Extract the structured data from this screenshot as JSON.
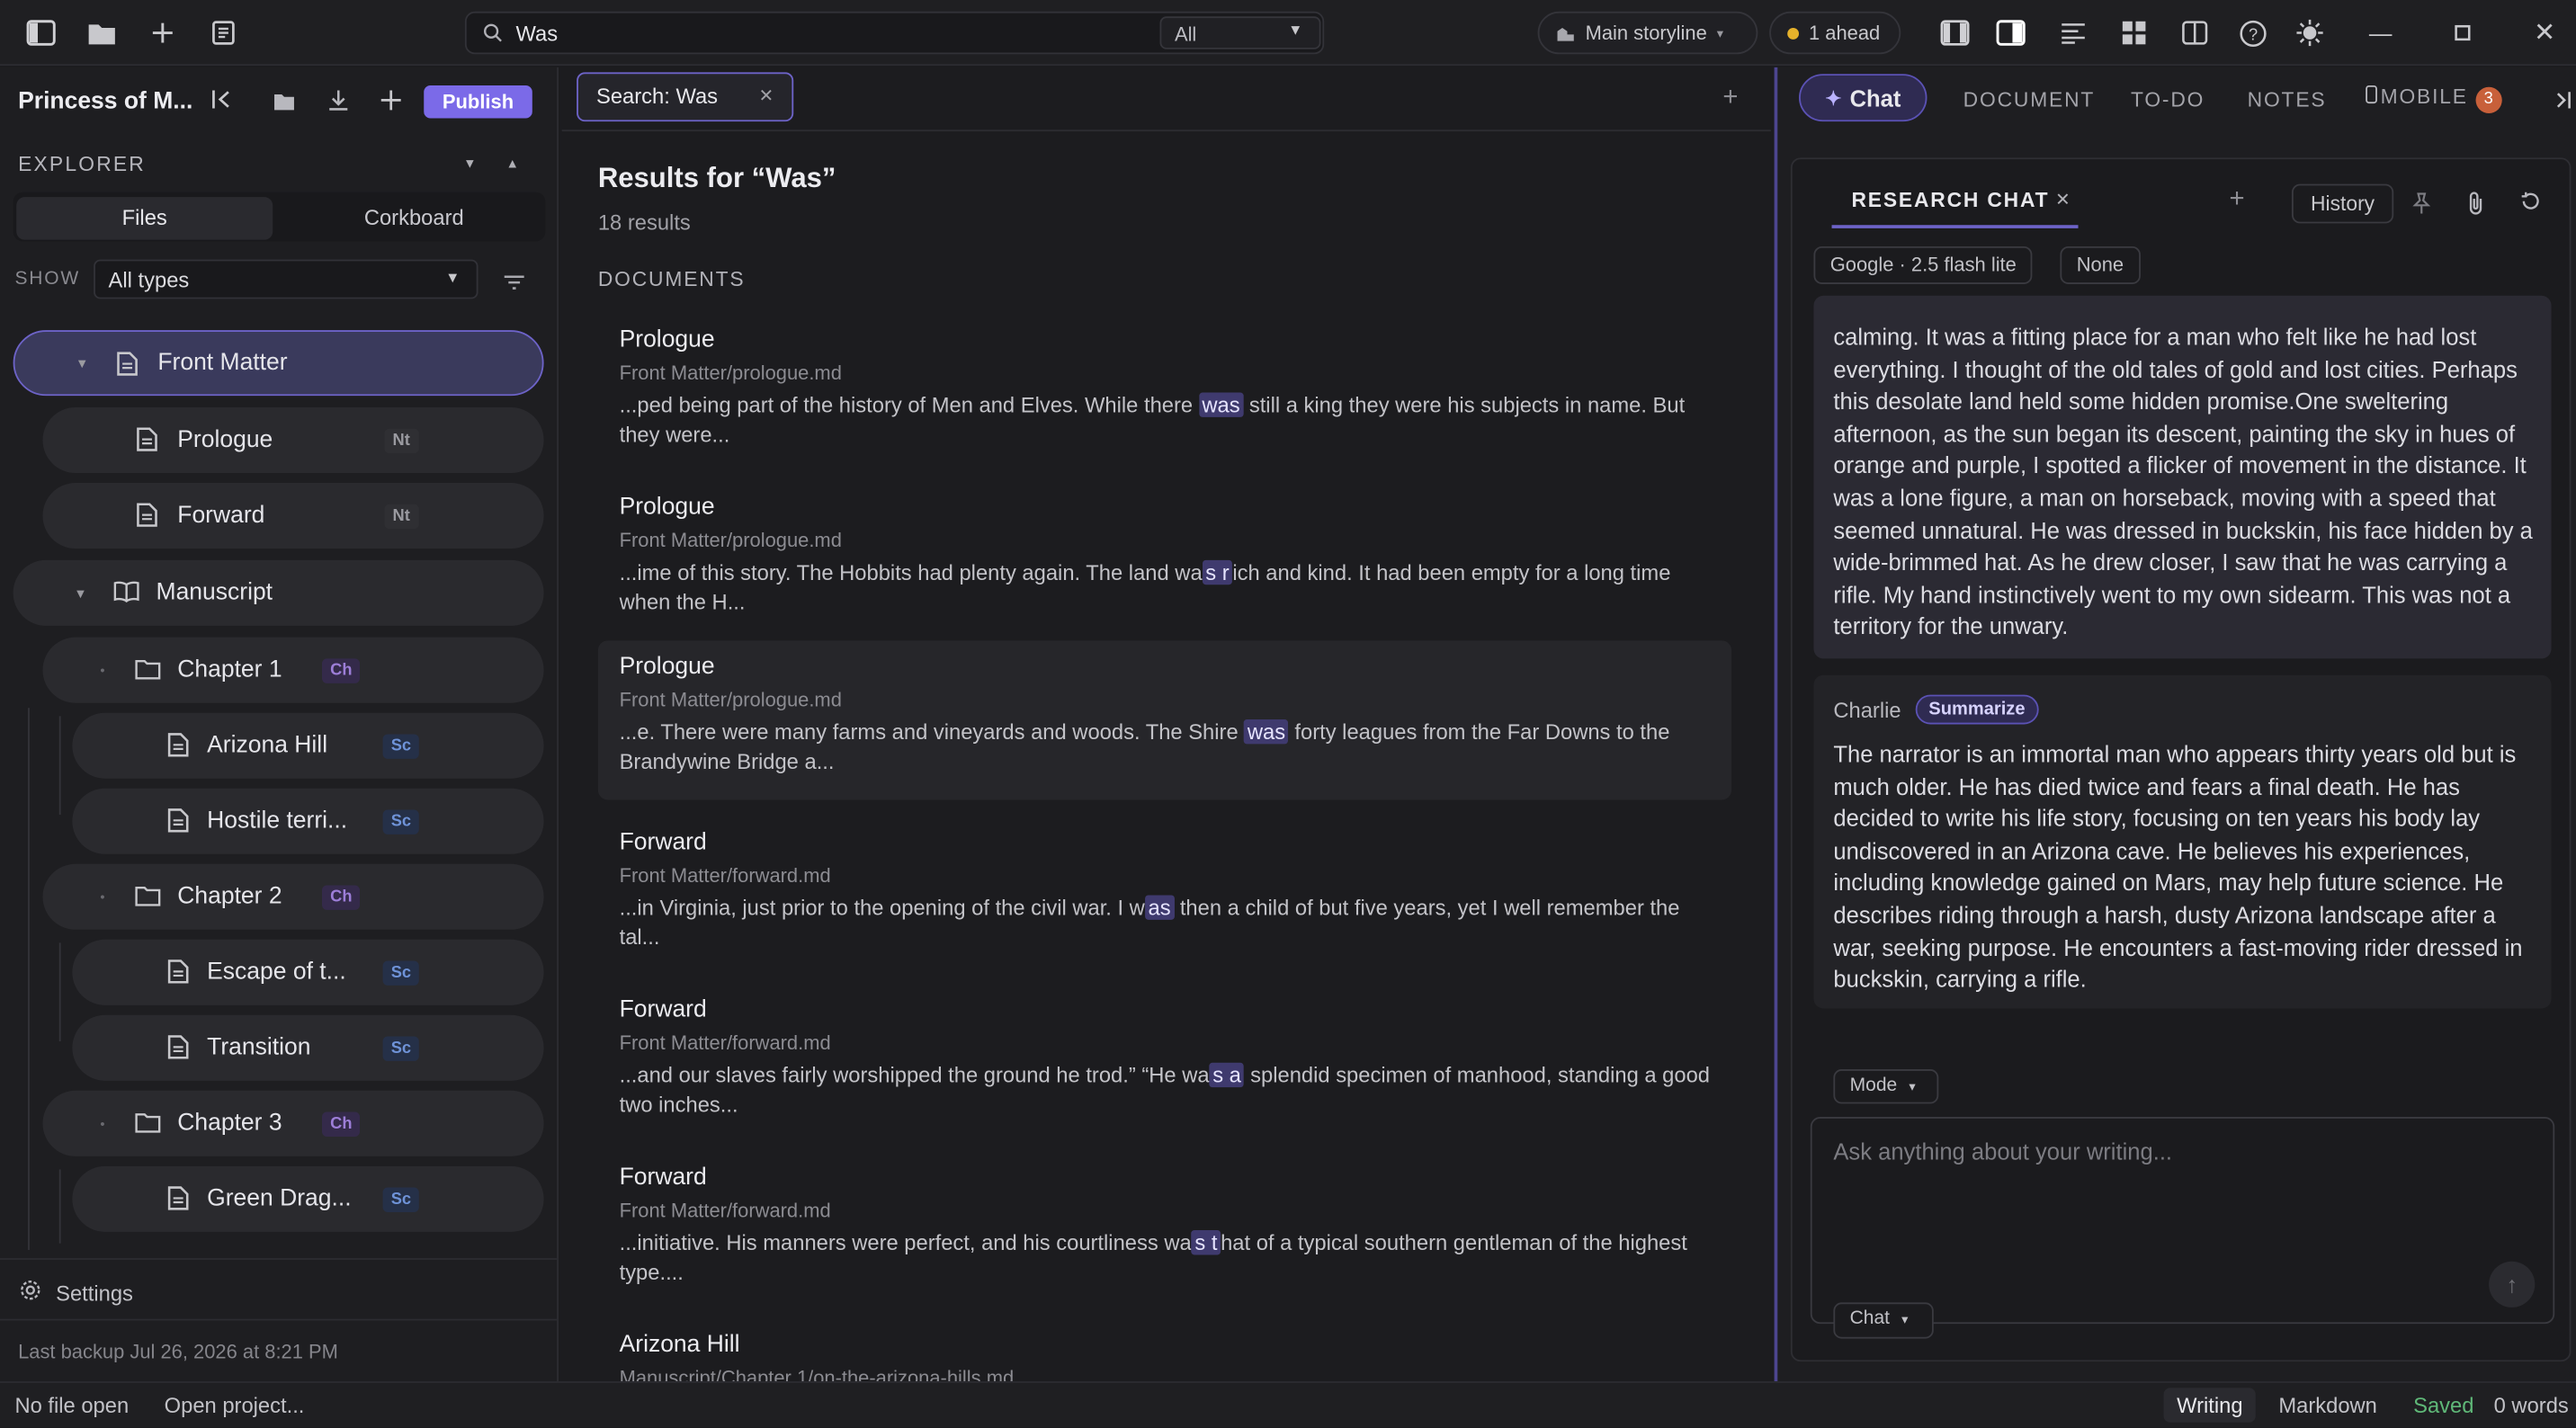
{
  "search": {
    "query": "Was",
    "scope": "All"
  },
  "topbar": {
    "storyline": "Main storyline",
    "ahead": "1 ahead"
  },
  "sidebar": {
    "project_title": "Princess of M...",
    "publish_label": "Publish",
    "explorer_label": "EXPLORER",
    "tabs": {
      "files": "Files",
      "corkboard": "Corkboard"
    },
    "show_label": "SHOW",
    "type_filter": "All types",
    "tree": [
      {
        "label": "Front Matter",
        "badge": ""
      },
      {
        "label": "Prologue",
        "badge": "Nt"
      },
      {
        "label": "Forward",
        "badge": "Nt"
      },
      {
        "label": "Manuscript",
        "badge": ""
      },
      {
        "label": "Chapter 1",
        "badge": "Ch"
      },
      {
        "label": "Arizona Hill",
        "badge": "Sc"
      },
      {
        "label": "Hostile terri...",
        "badge": "Sc"
      },
      {
        "label": "Chapter 2",
        "badge": "Ch"
      },
      {
        "label": "Escape of t...",
        "badge": "Sc"
      },
      {
        "label": "Transition",
        "badge": "Sc"
      },
      {
        "label": "Chapter 3",
        "badge": "Ch"
      },
      {
        "label": "Green Drag...",
        "badge": "Sc"
      }
    ],
    "settings_label": "Settings",
    "backup": "Last backup Jul 26, 2026 at 8:21 PM"
  },
  "main": {
    "tab_label": "Search: Was",
    "results_title": "Results for “Was”",
    "results_count": "18 results",
    "section_label": "DOCUMENTS",
    "results": [
      {
        "title": "Prologue",
        "path": "Front Matter/prologue.md",
        "pre": "...ped being part of the history of Men and Elves. While there ",
        "match": "was",
        "post": " still a king they were his subjects in name. But they were..."
      },
      {
        "title": "Prologue",
        "path": "Front Matter/prologue.md",
        "pre": "...ime of this story. The Hobbits had plenty again. The land wa",
        "match": "s r",
        "post": "ich and kind. It had been empty for a long time when the H..."
      },
      {
        "title": "Prologue",
        "path": "Front Matter/prologue.md",
        "pre": "...e. There were many farms and vineyards and woods. The Shire ",
        "match": "was",
        "post": " forty leagues from the Far Downs to the Brandywine Bridge a..."
      },
      {
        "title": "Forward",
        "path": "Front Matter/forward.md",
        "pre": "...in Virginia, just prior to the opening of the civil war. I w",
        "match": "as",
        "post": " then a child of but five years, yet I well remember the tal..."
      },
      {
        "title": "Forward",
        "path": "Front Matter/forward.md",
        "pre": "...and our slaves fairly worshipped the ground he trod.” “He wa",
        "match": "s a",
        "post": " splendid specimen of manhood, standing a good two inches..."
      },
      {
        "title": "Forward",
        "path": "Front Matter/forward.md",
        "pre": "...initiative. His manners were perfect, and his courtliness wa",
        "match": "s t",
        "post": "hat of a typical southern gentleman of the highest type...."
      },
      {
        "title": "Arizona Hill",
        "path": "Manuscript/Chapter 1/on-the-arizona-hills.md",
        "pre": "",
        "match": "",
        "post": ""
      }
    ]
  },
  "right": {
    "tabs": {
      "chat": "Chat",
      "document": "DOCUMENT",
      "todo": "TO-DO",
      "notes": "NOTES",
      "mobile": "MOBILE",
      "mobile_count": "3"
    },
    "research_chat_label": "RESEARCH CHAT",
    "history_label": "History",
    "model_chip": "Google · 2.5 flash lite",
    "context_chip": "None",
    "message1": "calming. It was a fitting place for a man who felt like he had lost everything. I thought of the old tales of gold and lost cities. Perhaps this desolate land held some hidden promise.One sweltering afternoon, as the sun began its descent, painting the sky in hues of orange and purple, I spotted a flicker of movement in the distance. It was a lone figure, a man on horseback, moving with a speed that seemed unnatural. He was dressed in buckskin, his face hidden by a wide-brimmed hat. As he drew closer, I saw that he was carrying a rifle. My hand instinctively went to my own sidearm. This was not a territory for the unwary.",
    "message2_author": "Charlie",
    "message2_tag": "Summarize",
    "message2": "The narrator is an immortal man who appears thirty years old but is much older. He has died twice and fears a final death. He has decided to write his life story, focusing on ten years his body lay undiscovered in an Arizona cave. He believes his experiences, including knowledge gained on Mars, may help future science. He describes riding through a harsh, dusty Arizona landscape after a war, seeking purpose. He encounters a fast-moving rider dressed in buckskin, carrying a rifle.",
    "mode_label": "Mode",
    "compose_placeholder": "Ask anything about your writing...",
    "chat_select": "Chat"
  },
  "status": {
    "file": "No file open",
    "open_project": "Open project...",
    "writing": "Writing",
    "markdown": "Markdown",
    "saved": "Saved",
    "words": "0 words"
  },
  "colors": {
    "accent": "#7b6ae8",
    "saved": "#5fb878",
    "ahead_dot": "#e5b12b"
  }
}
